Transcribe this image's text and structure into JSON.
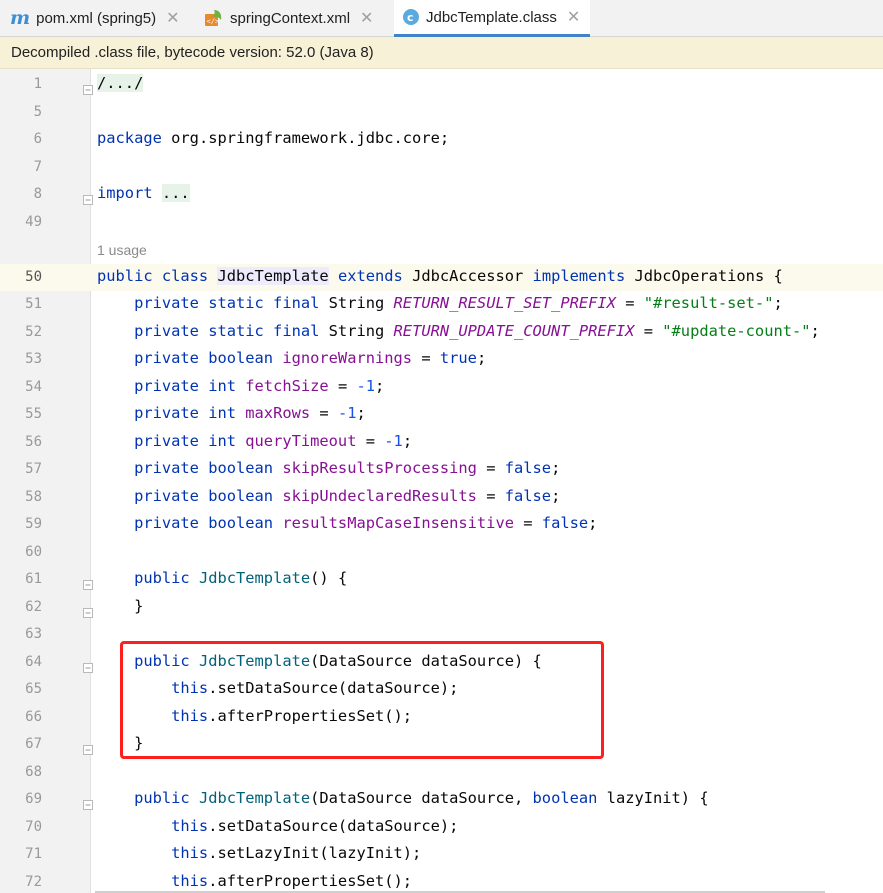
{
  "tabs": [
    {
      "label": "pom.xml (spring5)",
      "icon": "maven-icon"
    },
    {
      "label": "springContext.xml",
      "icon": "spring-xml-icon"
    },
    {
      "label": "JdbcTemplate.class",
      "icon": "class-icon",
      "active": true
    }
  ],
  "tab_close_glyph": "✕",
  "banner": {
    "text": "Decompiled .class file, bytecode version: 52.0 (Java 8)"
  },
  "usage_hint": "1 usage",
  "current_line": "50",
  "lines": [
    {
      "num": "1",
      "segments": [
        {
          "t": "/.../",
          "c": "fold-bg"
        }
      ]
    },
    {
      "num": "5",
      "segments": []
    },
    {
      "num": "6",
      "segments": [
        {
          "t": "package",
          "c": "k"
        },
        {
          "t": " org.springframework.jdbc.core;",
          "c": ""
        }
      ]
    },
    {
      "num": "7",
      "segments": []
    },
    {
      "num": "8",
      "segments": [
        {
          "t": "import",
          "c": "k"
        },
        {
          "t": " ",
          "c": ""
        },
        {
          "t": "...",
          "c": "fold-bg"
        }
      ]
    },
    {
      "num": "49",
      "segments": []
    },
    {
      "num": "",
      "usage": true,
      "segments": []
    },
    {
      "num": "50",
      "segments": [
        {
          "t": "public class ",
          "c": "k"
        },
        {
          "t": "JdbcTemplate",
          "c": "cls"
        },
        {
          "t": " extends ",
          "c": "k"
        },
        {
          "t": "JdbcAccessor",
          "c": ""
        },
        {
          "t": " implements ",
          "c": "k"
        },
        {
          "t": "JdbcOperations {",
          "c": ""
        }
      ]
    },
    {
      "num": "51",
      "segments": [
        {
          "t": "    private static final ",
          "c": "k"
        },
        {
          "t": "String ",
          "c": ""
        },
        {
          "t": "RETURN_RESULT_SET_PREFIX",
          "c": "cs"
        },
        {
          "t": " = ",
          "c": ""
        },
        {
          "t": "\"#result-set-\"",
          "c": "s"
        },
        {
          "t": ";",
          "c": ""
        }
      ]
    },
    {
      "num": "52",
      "segments": [
        {
          "t": "    private static final ",
          "c": "k"
        },
        {
          "t": "String ",
          "c": ""
        },
        {
          "t": "RETURN_UPDATE_COUNT_PREFIX",
          "c": "cs"
        },
        {
          "t": " = ",
          "c": ""
        },
        {
          "t": "\"#update-count-\"",
          "c": "s"
        },
        {
          "t": ";",
          "c": ""
        }
      ]
    },
    {
      "num": "53",
      "segments": [
        {
          "t": "    private boolean ",
          "c": "k"
        },
        {
          "t": "ignoreWarnings",
          "c": "f"
        },
        {
          "t": " = ",
          "c": ""
        },
        {
          "t": "true",
          "c": "k"
        },
        {
          "t": ";",
          "c": ""
        }
      ]
    },
    {
      "num": "54",
      "segments": [
        {
          "t": "    private int ",
          "c": "k"
        },
        {
          "t": "fetchSize",
          "c": "f"
        },
        {
          "t": " = ",
          "c": ""
        },
        {
          "t": "-1",
          "c": "n"
        },
        {
          "t": ";",
          "c": ""
        }
      ]
    },
    {
      "num": "55",
      "segments": [
        {
          "t": "    private int ",
          "c": "k"
        },
        {
          "t": "maxRows",
          "c": "f"
        },
        {
          "t": " = ",
          "c": ""
        },
        {
          "t": "-1",
          "c": "n"
        },
        {
          "t": ";",
          "c": ""
        }
      ]
    },
    {
      "num": "56",
      "segments": [
        {
          "t": "    private int ",
          "c": "k"
        },
        {
          "t": "queryTimeout",
          "c": "f"
        },
        {
          "t": " = ",
          "c": ""
        },
        {
          "t": "-1",
          "c": "n"
        },
        {
          "t": ";",
          "c": ""
        }
      ]
    },
    {
      "num": "57",
      "segments": [
        {
          "t": "    private boolean ",
          "c": "k"
        },
        {
          "t": "skipResultsProcessing",
          "c": "f"
        },
        {
          "t": " = ",
          "c": ""
        },
        {
          "t": "false",
          "c": "k"
        },
        {
          "t": ";",
          "c": ""
        }
      ]
    },
    {
      "num": "58",
      "segments": [
        {
          "t": "    private boolean ",
          "c": "k"
        },
        {
          "t": "skipUndeclaredResults",
          "c": "f"
        },
        {
          "t": " = ",
          "c": ""
        },
        {
          "t": "false",
          "c": "k"
        },
        {
          "t": ";",
          "c": ""
        }
      ]
    },
    {
      "num": "59",
      "segments": [
        {
          "t": "    private boolean ",
          "c": "k"
        },
        {
          "t": "resultsMapCaseInsensitive",
          "c": "f"
        },
        {
          "t": " = ",
          "c": ""
        },
        {
          "t": "false",
          "c": "k"
        },
        {
          "t": ";",
          "c": ""
        }
      ]
    },
    {
      "num": "60",
      "segments": []
    },
    {
      "num": "61",
      "segments": [
        {
          "t": "    public ",
          "c": "k"
        },
        {
          "t": "JdbcTemplate",
          "c": "m"
        },
        {
          "t": "() {",
          "c": ""
        }
      ]
    },
    {
      "num": "62",
      "segments": [
        {
          "t": "    }",
          "c": ""
        }
      ]
    },
    {
      "num": "63",
      "segments": []
    },
    {
      "num": "64",
      "segments": [
        {
          "t": "    public ",
          "c": "k"
        },
        {
          "t": "JdbcTemplate",
          "c": "m"
        },
        {
          "t": "(DataSource dataSource) {",
          "c": ""
        }
      ]
    },
    {
      "num": "65",
      "segments": [
        {
          "t": "        this",
          "c": "k"
        },
        {
          "t": ".setDataSource(dataSource);",
          "c": ""
        }
      ]
    },
    {
      "num": "66",
      "segments": [
        {
          "t": "        this",
          "c": "k"
        },
        {
          "t": ".afterPropertiesSet();",
          "c": ""
        }
      ]
    },
    {
      "num": "67",
      "segments": [
        {
          "t": "    }",
          "c": ""
        }
      ]
    },
    {
      "num": "68",
      "segments": []
    },
    {
      "num": "69",
      "segments": [
        {
          "t": "    public ",
          "c": "k"
        },
        {
          "t": "JdbcTemplate",
          "c": "m"
        },
        {
          "t": "(DataSource dataSource, ",
          "c": ""
        },
        {
          "t": "boolean",
          "c": "k"
        },
        {
          "t": " lazyInit) {",
          "c": ""
        }
      ]
    },
    {
      "num": "70",
      "segments": [
        {
          "t": "        this",
          "c": "k"
        },
        {
          "t": ".setDataSource(dataSource);",
          "c": ""
        }
      ]
    },
    {
      "num": "71",
      "segments": [
        {
          "t": "        this",
          "c": "k"
        },
        {
          "t": ".setLazyInit(lazyInit);",
          "c": ""
        }
      ]
    },
    {
      "num": "72",
      "segments": [
        {
          "t": "        this",
          "c": "k"
        },
        {
          "t": ".afterPropertiesSet();",
          "c": ""
        }
      ]
    }
  ],
  "fold_markers": [
    "1",
    "8",
    "61",
    "62",
    "64",
    "67",
    "69"
  ]
}
